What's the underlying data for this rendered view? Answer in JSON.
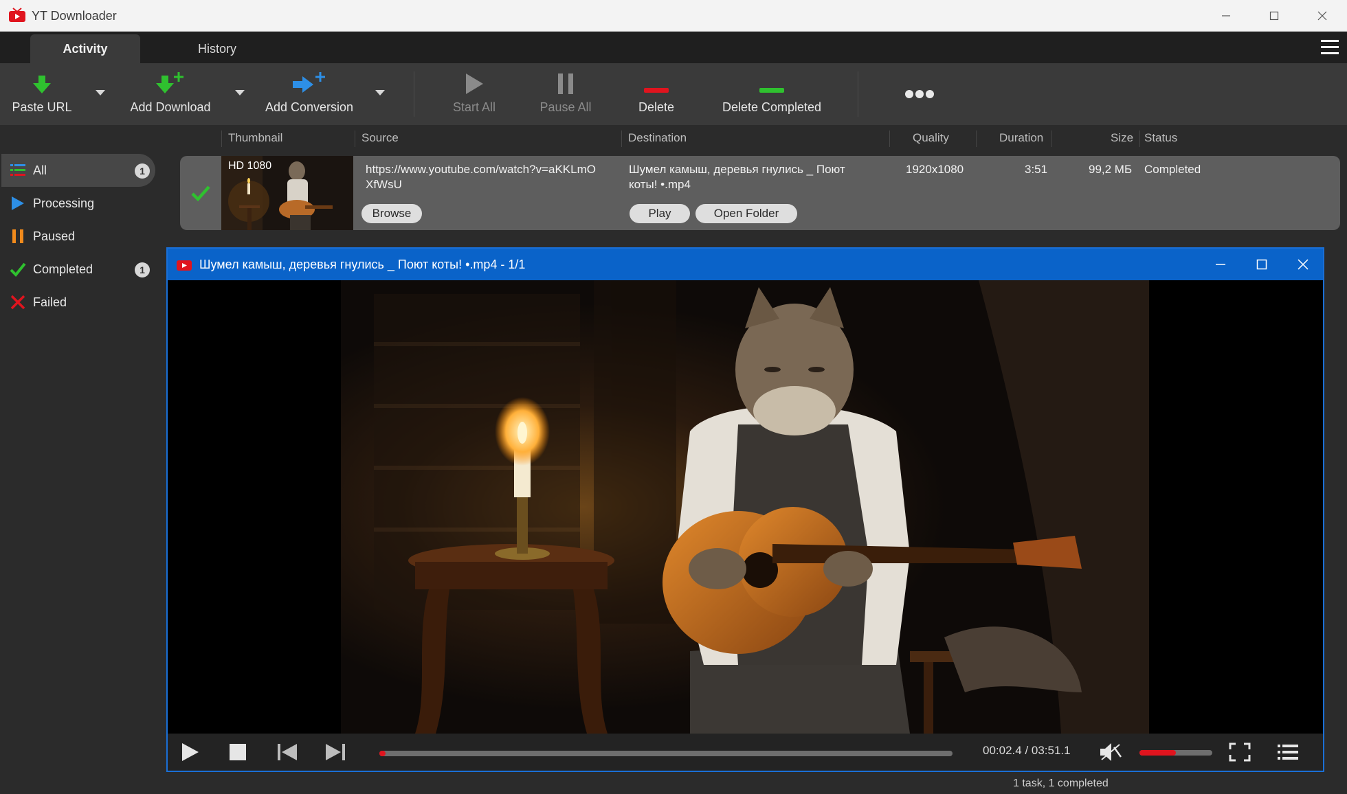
{
  "window": {
    "title": "YT Downloader"
  },
  "tabs": [
    {
      "label": "Activity",
      "active": true
    },
    {
      "label": "History",
      "active": false
    }
  ],
  "toolbar": {
    "paste_url": "Paste URL",
    "add_download": "Add Download",
    "add_conversion": "Add Conversion",
    "start_all": "Start All",
    "pause_all": "Pause All",
    "delete": "Delete",
    "delete_completed": "Delete Completed"
  },
  "sidebar": {
    "items": [
      {
        "label": "All",
        "icon": "list-icon",
        "badge": "1",
        "active": true
      },
      {
        "label": "Processing",
        "icon": "play-icon"
      },
      {
        "label": "Paused",
        "icon": "pause-icon"
      },
      {
        "label": "Completed",
        "icon": "check-icon",
        "badge": "1"
      },
      {
        "label": "Failed",
        "icon": "x-icon"
      }
    ]
  },
  "columns": [
    "Thumbnail",
    "Source",
    "Destination",
    "Quality",
    "Duration",
    "Size",
    "Status"
  ],
  "download": {
    "badge": "HD 1080",
    "source_line1": "https://www.youtube.com/watch?v=aKKLmO",
    "source_line2": "XfWsU",
    "browse": "Browse",
    "destination_line1": "Шумел камыш, деревья гнулись _ Поют",
    "destination_line2": "коты! •.mp4",
    "play": "Play",
    "open_folder": "Open Folder",
    "quality": "1920x1080",
    "duration": "3:51",
    "size": "99,2 МБ",
    "status": "Completed"
  },
  "player": {
    "title": "Шумел камыш, деревья гнулись _ Поют коты! •.mp4 - 1/1",
    "time": "00:02.4 / 03:51.1",
    "progress": 0.011,
    "volume": 0.5
  },
  "status": {
    "text": "1 task, 1 completed"
  },
  "colors": {
    "accent": "#0a63c9",
    "green": "#2fc12f",
    "red": "#e0141e",
    "blue": "#2d8fe6",
    "orange": "#f08a1c"
  }
}
